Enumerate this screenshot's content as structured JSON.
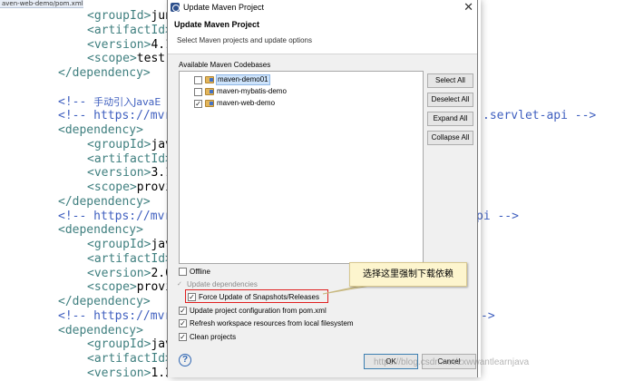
{
  "editor": {
    "tab_title": "aven-web-demo/pom.xml",
    "tab_close": "×",
    "lines": [
      {
        "indent": 96,
        "parts": [
          {
            "c": "tag",
            "t": "<groupId>"
          },
          {
            "c": "txt",
            "t": "jun"
          }
        ]
      },
      {
        "indent": 96,
        "parts": [
          {
            "c": "tag",
            "t": "<artifactId>"
          }
        ]
      },
      {
        "indent": 96,
        "parts": [
          {
            "c": "tag",
            "t": "<version>"
          },
          {
            "c": "txt",
            "t": "4.1"
          }
        ]
      },
      {
        "indent": 96,
        "parts": [
          {
            "c": "tag",
            "t": "<scope>"
          },
          {
            "c": "txt",
            "t": "test"
          }
        ]
      },
      {
        "indent": 64,
        "parts": [
          {
            "c": "tag",
            "t": "</dependency>"
          }
        ]
      },
      {
        "indent": 64,
        "parts": []
      },
      {
        "indent": 64,
        "parts": [
          {
            "c": "cmt",
            "t": "<!-- "
          },
          {
            "c": "cmt-cn",
            "t": "手动引入JavaE"
          }
        ]
      },
      {
        "indent": 64,
        "parts": [
          {
            "c": "cmt",
            "t": "<!-- https://mvr"
          }
        ]
      },
      {
        "indent": 64,
        "parts": [
          {
            "c": "tag",
            "t": "<dependency>"
          }
        ]
      },
      {
        "indent": 96,
        "parts": [
          {
            "c": "tag",
            "t": "<groupId>"
          },
          {
            "c": "txt",
            "t": "jav"
          }
        ]
      },
      {
        "indent": 96,
        "parts": [
          {
            "c": "tag",
            "t": "<artifactId>"
          }
        ]
      },
      {
        "indent": 96,
        "parts": [
          {
            "c": "tag",
            "t": "<version>"
          },
          {
            "c": "txt",
            "t": "3.1"
          }
        ]
      },
      {
        "indent": 96,
        "parts": [
          {
            "c": "tag",
            "t": "<scope>"
          },
          {
            "c": "txt",
            "t": "provi"
          }
        ]
      },
      {
        "indent": 64,
        "parts": [
          {
            "c": "tag",
            "t": "</dependency>"
          }
        ]
      },
      {
        "indent": 64,
        "parts": [
          {
            "c": "cmt",
            "t": "<!-- https://mvr"
          }
        ]
      },
      {
        "indent": 64,
        "parts": [
          {
            "c": "tag",
            "t": "<dependency>"
          }
        ]
      },
      {
        "indent": 96,
        "parts": [
          {
            "c": "tag",
            "t": "<groupId>"
          },
          {
            "c": "txt",
            "t": "jav"
          }
        ]
      },
      {
        "indent": 96,
        "parts": [
          {
            "c": "tag",
            "t": "<artifactId>"
          }
        ]
      },
      {
        "indent": 96,
        "parts": [
          {
            "c": "tag",
            "t": "<version>"
          },
          {
            "c": "txt",
            "t": "2.0"
          }
        ]
      },
      {
        "indent": 96,
        "parts": [
          {
            "c": "tag",
            "t": "<scope>"
          },
          {
            "c": "txt",
            "t": "provi"
          }
        ]
      },
      {
        "indent": 64,
        "parts": [
          {
            "c": "tag",
            "t": "</dependency>"
          }
        ]
      },
      {
        "indent": 64,
        "parts": [
          {
            "c": "cmt",
            "t": "<!-- https://mvr"
          }
        ]
      },
      {
        "indent": 64,
        "parts": [
          {
            "c": "tag",
            "t": "<dependency>"
          }
        ]
      },
      {
        "indent": 96,
        "parts": [
          {
            "c": "tag",
            "t": "<groupId>"
          },
          {
            "c": "txt",
            "t": "jav"
          }
        ]
      },
      {
        "indent": 96,
        "parts": [
          {
            "c": "tag",
            "t": "<artifactId>"
          }
        ]
      },
      {
        "indent": 96,
        "parts": [
          {
            "c": "tag",
            "t": "<version>"
          },
          {
            "c": "txt",
            "t": "1.2"
          }
        ]
      }
    ],
    "right_fragments": [
      {
        "line": 7,
        "indent": 532,
        "c": "cmt",
        "t": ".servlet-api -->"
      },
      {
        "line": 14,
        "indent": 525,
        "c": "cmt",
        "t": "pi -->"
      },
      {
        "line": 21,
        "indent": 530,
        "c": "cmt",
        "t": "->"
      }
    ]
  },
  "dialog": {
    "window_title": "Update Maven Project",
    "close_glyph": "✕",
    "header_title": "Update Maven Project",
    "header_desc": "Select Maven projects and update options",
    "codebases_label": "Available Maven Codebases",
    "projects": [
      {
        "name": "maven-demo01",
        "checked": false,
        "check_glyph": "",
        "selected": true
      },
      {
        "name": "maven-mybatis-demo",
        "checked": false,
        "check_glyph": "",
        "selected": false
      },
      {
        "name": "maven-web-demo",
        "checked": true,
        "check_glyph": "✓",
        "selected": false
      }
    ],
    "side_buttons": {
      "select_all": "Select All",
      "deselect_all": "Deselect All",
      "expand_all": "Expand All",
      "collapse_all": "Collapse All"
    },
    "options": {
      "offline": {
        "label": "Offline",
        "checked": false,
        "check_glyph": ""
      },
      "update_dependencies": {
        "label": "Update dependencies",
        "check_glyph": "✓"
      },
      "force_update": {
        "label": "Force Update of Snapshots/Releases",
        "checked": true,
        "check_glyph": "✓"
      },
      "update_config": {
        "label": "Update project configuration from pom.xml",
        "checked": true,
        "check_glyph": "✓"
      },
      "refresh_workspace": {
        "label": "Refresh workspace resources from local filesystem",
        "checked": true,
        "check_glyph": "✓"
      },
      "clean_projects": {
        "label": "Clean projects",
        "checked": true,
        "check_glyph": "✓"
      }
    },
    "help_glyph": "?",
    "ok_label": "OK",
    "cancel_label": "Cancel"
  },
  "callout": {
    "text": "选择这里强制下载依赖"
  },
  "watermark": "https://blog.csdn.net/zxwwantlearnjava",
  "colors": {
    "annotation_border": "#e02020",
    "callout_bg": "#fdf5ce",
    "tag": "#3f7f7f",
    "comment": "#3f5fbf"
  }
}
